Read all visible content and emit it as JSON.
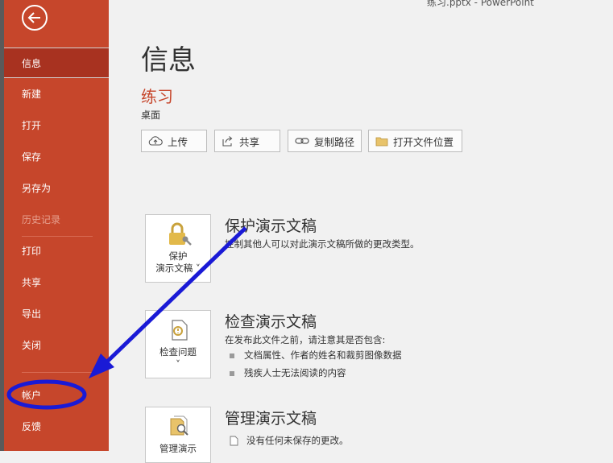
{
  "window": {
    "title": "练习.pptx  -  PowerPoint"
  },
  "sidebar": {
    "items": [
      {
        "label": "信息"
      },
      {
        "label": "新建"
      },
      {
        "label": "打开"
      },
      {
        "label": "保存"
      },
      {
        "label": "另存为"
      },
      {
        "label": "历史记录"
      },
      {
        "label": "打印"
      },
      {
        "label": "共享"
      },
      {
        "label": "导出"
      },
      {
        "label": "关闭"
      },
      {
        "label": "帐户"
      },
      {
        "label": "反馈"
      }
    ]
  },
  "main": {
    "page_title": "信息",
    "file_name": "练习",
    "file_location": "桌面",
    "buttons": [
      {
        "label": "上传",
        "icon": "upload-cloud-icon"
      },
      {
        "label": "共享",
        "icon": "share-icon"
      },
      {
        "label": "复制路径",
        "icon": "link-icon"
      },
      {
        "label": "打开文件位置",
        "icon": "folder-icon"
      }
    ],
    "sections": [
      {
        "title": "保护演示文稿",
        "tile_line1": "保护",
        "tile_line2": "演示文稿 ˅",
        "description": "控制其他人可以对此演示文稿所做的更改类型。"
      },
      {
        "title": "检查演示文稿",
        "tile_line1": "检查问题",
        "tile_line2": "˅",
        "description": "在发布此文件之前，请注意其是否包含:",
        "bullets": [
          "文档属性、作者的姓名和裁剪图像数据",
          "残疾人士无法阅读的内容"
        ]
      },
      {
        "title": "管理演示文稿",
        "tile_line1": "管理演示",
        "description": "没有任何未保存的更改。"
      }
    ]
  },
  "colors": {
    "sidebar": "#c6462b",
    "selected": "#a83220",
    "annotation": "#1a1ad6"
  }
}
